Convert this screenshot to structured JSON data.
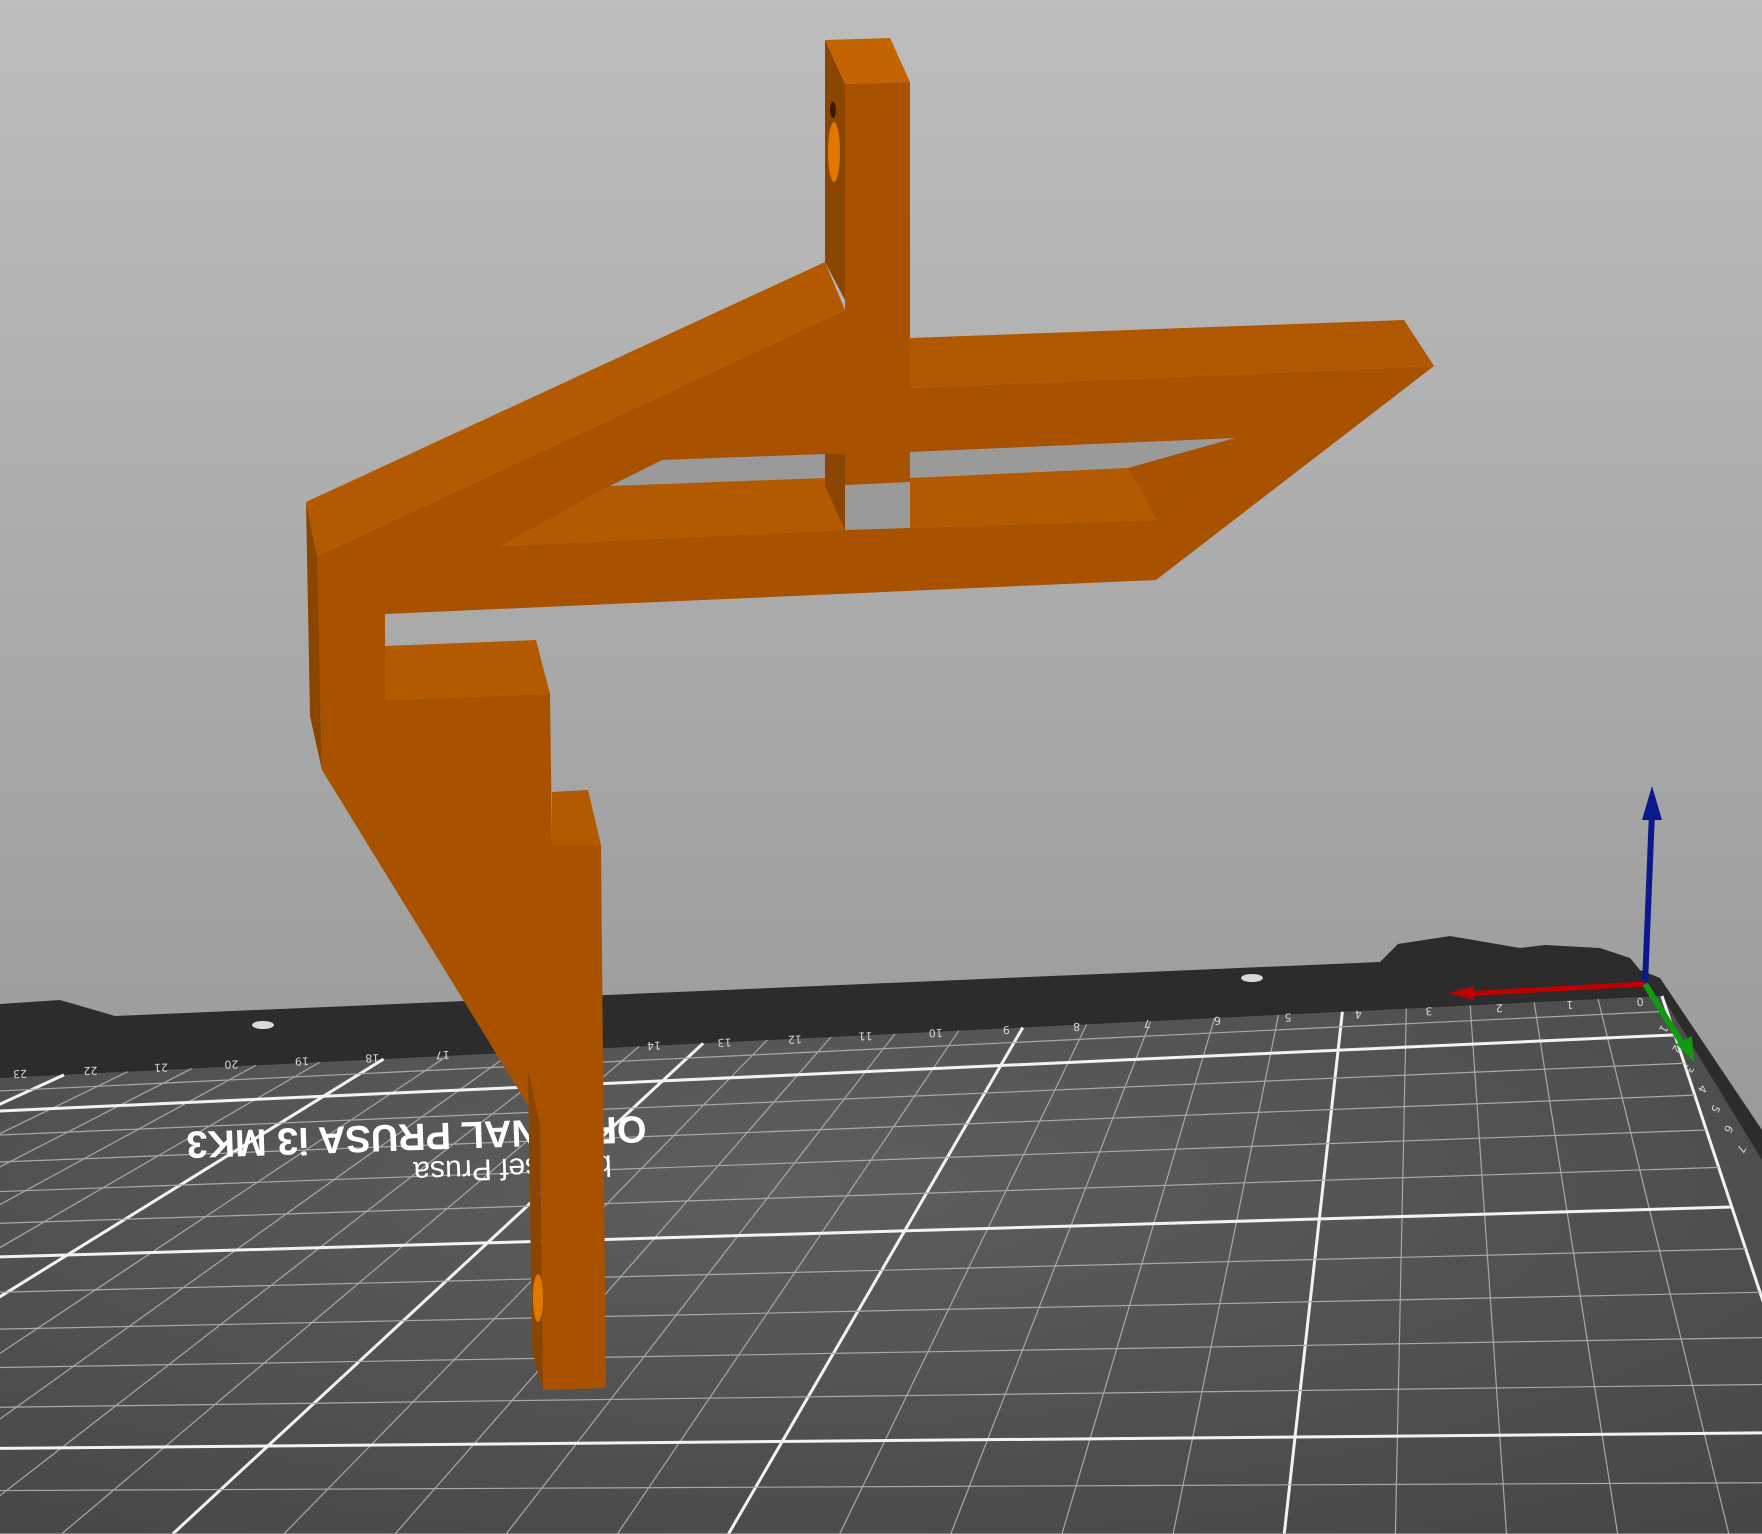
{
  "app": {
    "view": "3D plater view"
  },
  "bed": {
    "logo_line1": "ORIGINAL PRUSA i3 MK3",
    "logo_line2": "by Josef Prusa",
    "x_ruler_labels": [
      "23",
      "22",
      "21",
      "20",
      "19",
      "18",
      "17",
      "16",
      "15",
      "14",
      "13",
      "12",
      "11",
      "10",
      "9",
      "8",
      "7",
      "6",
      "5",
      "4",
      "3",
      "2",
      "1",
      "0"
    ],
    "y_ruler_labels": [
      "1",
      "2",
      "3",
      "4",
      "5",
      "6",
      "7"
    ]
  },
  "model": {
    "color": "#b35a00",
    "shade_dark": "#8a4500",
    "shade_light": "#c46400",
    "hole_color": "#e07800"
  },
  "axes": {
    "x_color": "#c00000",
    "y_color": "#119911",
    "z_color": "#0a1a8c"
  },
  "colors": {
    "background_top": "#bdbdbd",
    "background_bottom": "#8e8e8e",
    "bed_plate": "#2c2c2c",
    "bed_surface": "#555555"
  }
}
